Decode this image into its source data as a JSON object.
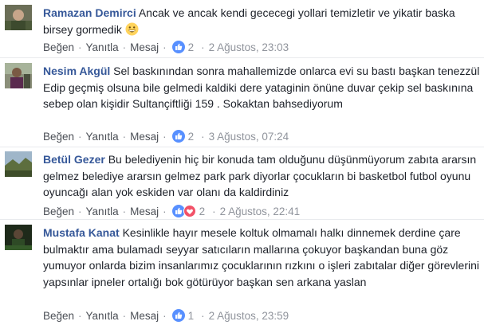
{
  "colors": {
    "link": "#365899",
    "meta": "#90949c",
    "like_blue": "#5890ff",
    "haha_yellow": "#ffd35c",
    "love_red": "#f25268"
  },
  "actions": {
    "like": "Beğen",
    "reply": "Yanıtla",
    "message": "Mesaj",
    "dot": "·"
  },
  "comments": [
    {
      "author": "Ramazan Demirci",
      "text": "Ancak ve ancak kendi gececegi yollari temizletir ve yikatir baska birsey gormedik",
      "emoji": "grinning-face",
      "reactions": [
        "like-icon"
      ],
      "reaction_count": "2",
      "timestamp": "2 Ağustos, 23:03"
    },
    {
      "author": "Nesim Akgül",
      "text": "Sel baskınından sonra mahallemizde onlarca evi su bastı başkan tenezzül Edip geçmiş olsuna bile gelmedi kaldiki dere yataginin önüne duvar çekip sel baskınına sebep olan kişidir Sultançiftliği 159 . Sokaktan bahsediyorum",
      "reactions": [
        "like-icon"
      ],
      "reaction_count": "2",
      "timestamp": "3 Ağustos, 07:24"
    },
    {
      "author": "Betül Gezer",
      "text": "Bu belediyenin hiç bir konuda tam olduğunu düşünmüyorum zabıta ararsın gelmez belediye ararsın gelmez park park diyorlar çocukların bi basketbol futbol oyunu oyuncağı alan yok eskiden var olanı da kaldirdiniz",
      "reactions": [
        "like-icon",
        "love-icon"
      ],
      "reaction_count": "2",
      "timestamp": "2 Ağustos, 22:41"
    },
    {
      "author": "Mustafa Kanat",
      "text": "Kesinlikle hayır mesele koltuk olmamalı halkı dinnemek derdine çare bulmaktır ama bulamadı seyyar satıcıların mallarına çokuyor başkandan buna göz yumuyor onlarda bizim insanlarımız çocuklarının rızkını o işleri zabıtalar diğer görevlerini yapsınlar ipneler ortalığı bok götürüyor başkan sen arkana yaslan",
      "reactions": [
        "like-icon"
      ],
      "reaction_count": "1",
      "timestamp": "2 Ağustos, 23:59"
    }
  ]
}
